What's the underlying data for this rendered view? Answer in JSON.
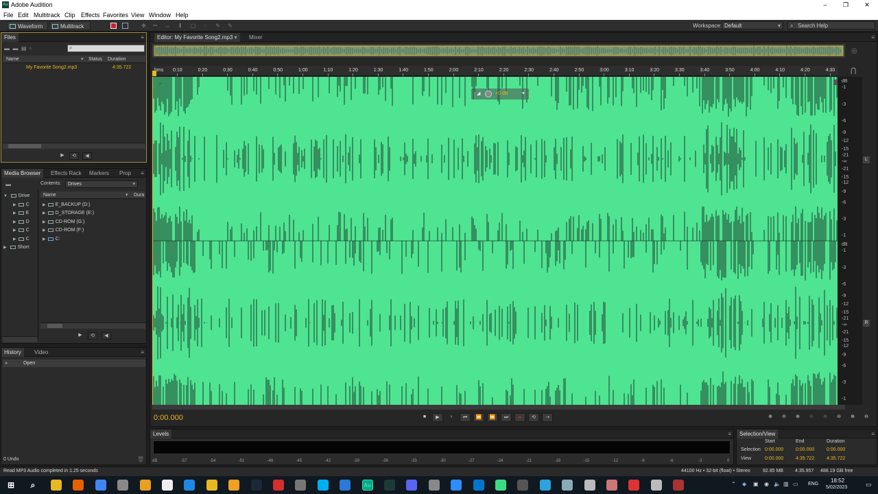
{
  "app": {
    "title": "Adobe Audition",
    "icon_label": "Au"
  },
  "window_controls": {
    "minimize": "–",
    "maximize": "❐",
    "close": "✕"
  },
  "menu": [
    "File",
    "Edit",
    "Multitrack",
    "Clip",
    "Effects",
    "Favorites",
    "View",
    "Window",
    "Help"
  ],
  "toolbar": {
    "waveform_label": "Waveform",
    "multitrack_label": "Multitrack",
    "workspace_label": "Workspace:",
    "workspace_value": "Default",
    "search_placeholder": "Search Help"
  },
  "files_panel": {
    "tab": "Files",
    "columns": {
      "name": "Name",
      "status": "Status",
      "duration": "Duration"
    },
    "items": [
      {
        "name": "My Favorite Song2.mp3",
        "duration": "4:35.722"
      }
    ]
  },
  "media_browser": {
    "tabs": [
      "Media Browser",
      "Effects Rack",
      "Markers",
      "Prop"
    ],
    "contents_label": "Contents:",
    "contents_value": "Drives",
    "tree": [
      "Drive",
      "E",
      "D",
      "C",
      "C",
      "Short"
    ],
    "tree_first_child": "C",
    "list_columns": {
      "name": "Name",
      "duration": "Dura"
    },
    "drives": [
      "E_BACKUP (D:)",
      "D_STORAGE (E:)",
      "CD-ROM (G:)",
      "CD-ROM (F:)",
      "C:"
    ]
  },
  "history_panel": {
    "tabs": [
      "History",
      "Video"
    ],
    "items": [
      "Open"
    ],
    "undo_count": "0 Undo"
  },
  "editor": {
    "tab_label": "Editor: My Favorite Song2.mp3",
    "mixer_label": "Mixer",
    "ruler_start": "hms",
    "ruler_labels": [
      "0:10",
      "0:20",
      "0:30",
      "0:40",
      "0:50",
      "1:00",
      "1:10",
      "1:20",
      "1:30",
      "1:40",
      "1:50",
      "2:00",
      "2:10",
      "2:20",
      "2:30",
      "2:40",
      "2:50",
      "3:00",
      "3:10",
      "3:20",
      "3:30",
      "3:40",
      "3:50",
      "4:00",
      "4:10",
      "4:20",
      "4:30"
    ],
    "hud_gain": "+0 dB",
    "db_scale_top": [
      "dB",
      "-1",
      "-3",
      "-6",
      "-9",
      "-12",
      "-15",
      "-21",
      "-∞",
      "-21",
      "-15",
      "-12",
      "-9",
      "-6",
      "-3",
      "-1"
    ],
    "db_scale_bottom": [
      "dB",
      "-1",
      "-3",
      "-6",
      "-9",
      "-12",
      "-15",
      "-21",
      "-∞",
      "-21",
      "-15",
      "-12",
      "-9",
      "-6",
      "-3",
      "-1"
    ],
    "channel_left": "L",
    "channel_right": "R",
    "waveform_color": "#4ee492",
    "current_time": "0:00.000"
  },
  "transport": [
    "■",
    "▶",
    "⏸",
    "⏮",
    "⏪",
    "⏩",
    "⏭",
    "●",
    "⟲",
    "⇢"
  ],
  "zoom_buttons": [
    "⊕",
    "⊖",
    "⊕",
    "⊖",
    "⊕",
    "⊖",
    "⊕",
    "⊖"
  ],
  "levels_panel": {
    "tab": "Levels",
    "ticks": [
      "dB",
      "-57",
      "-54",
      "-51",
      "-48",
      "-45",
      "-42",
      "-39",
      "-36",
      "-33",
      "-30",
      "-27",
      "-24",
      "-21",
      "-18",
      "-15",
      "-12",
      "-9",
      "-6",
      "-3",
      "0"
    ]
  },
  "selection_view": {
    "tab": "Selection/View",
    "headers": {
      "start": "Start",
      "end": "End",
      "duration": "Duration"
    },
    "selection": {
      "label": "Selection",
      "start": "0:00.000",
      "end": "0:00.000",
      "duration": "0:00.000"
    },
    "view": {
      "label": "View",
      "start": "0:00.000",
      "end": "4:35.722",
      "duration": "4:35.722"
    }
  },
  "status_bar": {
    "message": "Read MP3 Audio completed in 1.25 seconds",
    "format": "44100 Hz • 32-bit (float) • Stereo",
    "size": "92.85 MB",
    "duration": "4:35.957",
    "free": "488.19 GB free"
  },
  "taskbar": {
    "icons": [
      "file-explorer",
      "firefox",
      "chrome",
      "app",
      "folder",
      "app",
      "norton",
      "app",
      "steam",
      "gmail",
      "app",
      "skype",
      "app",
      "app",
      "audition",
      "discord",
      "app",
      "zoom",
      "app",
      "android",
      "app",
      "telegram",
      "app",
      "app",
      "app",
      "app",
      "app",
      "app",
      "steam-bubble"
    ],
    "audition_label": "Au",
    "language": "ENG",
    "time": "18:52",
    "date": "5/02/2023"
  }
}
